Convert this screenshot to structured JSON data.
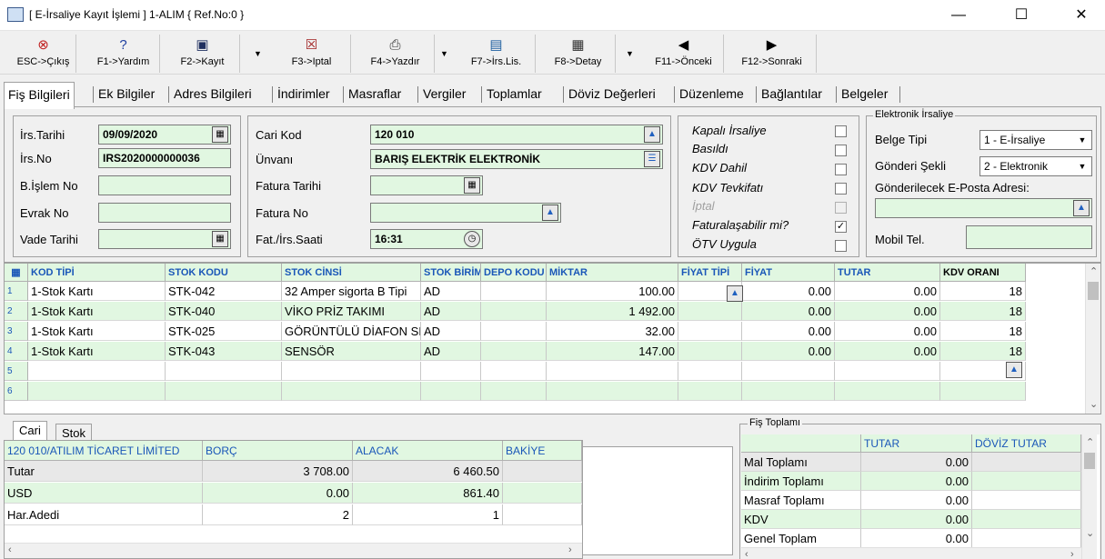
{
  "window": {
    "title": "[ E-İrsaliye Kayıt İşlemi ] 1-ALIM { Ref.No:0 }",
    "minimize": "—",
    "maximize": "☐",
    "close": "✕"
  },
  "toolbar": [
    {
      "label": "ESC->Çıkış",
      "icon": "⊗",
      "color": "#c02020"
    },
    {
      "label": "F1->Yardım",
      "icon": "❓",
      "color": "#2040a0"
    },
    {
      "label": "F2->Kayıt",
      "icon": "🖫",
      "color": "#203060"
    },
    {
      "label": "F3->Iptal",
      "icon": "☒",
      "color": "#a02020"
    },
    {
      "label": "F4->Yazdır",
      "icon": "⎙",
      "color": "#303030"
    },
    {
      "label": "F7->İrs.Lis.",
      "icon": "▤",
      "color": "#2060a0"
    },
    {
      "label": "F8->Detay",
      "icon": "▦",
      "color": "#303030"
    },
    {
      "label": "F11->Önceki",
      "icon": "◆",
      "color": "#000000"
    },
    {
      "label": "F12->Sonraki",
      "icon": "◆",
      "color": "#000000"
    }
  ],
  "tabs": [
    "Fiş Bilgileri",
    "Ek Bilgiler",
    "Adres Bilgileri",
    "İndirimler",
    "Masraflar",
    "Vergiler",
    "Toplamlar",
    "Döviz Değerleri",
    "Düzenleme",
    "Bağlantılar",
    "Belgeler"
  ],
  "form": {
    "irs_tarihi_label": "İrs.Tarihi",
    "irs_tarihi": "09/09/2020",
    "irs_no_label": "İrs.No",
    "irs_no": "IRS2020000000036",
    "bislem_label": "B.İşlem No",
    "bislem": "",
    "evrak_label": "Evrak No",
    "evrak": "",
    "vade_label": "Vade Tarihi",
    "vade": "",
    "cari_kod_label": "Cari Kod",
    "cari_kod": "120 010",
    "unvan_label": "Ünvanı",
    "unvan": "BARIŞ ELEKTRİK ELEKTRONİK",
    "fatura_tarihi_label": "Fatura Tarihi",
    "fatura_tarihi": "",
    "fatura_no_label": "Fatura No",
    "fatura_no": "",
    "saat_label": "Fat./İrs.Saati",
    "saat": "16:31"
  },
  "checks": [
    {
      "label": "Kapalı İrsaliye",
      "checked": false,
      "disabled": false
    },
    {
      "label": "Basıldı",
      "checked": false,
      "disabled": false
    },
    {
      "label": "KDV Dahil",
      "checked": false,
      "disabled": false
    },
    {
      "label": "KDV Tevkifatı",
      "checked": false,
      "disabled": false
    },
    {
      "label": "İptal",
      "checked": false,
      "disabled": true
    },
    {
      "label": "Faturalaşabilir mi?",
      "checked": true,
      "disabled": false
    },
    {
      "label": "ÖTV Uygula",
      "checked": false,
      "disabled": false
    }
  ],
  "einv": {
    "legend": "Elektronik İrsaliye",
    "belge_label": "Belge Tipi",
    "belge": "1 - E-İrsaliye",
    "gonderi_label": "Gönderi Şekli",
    "gonderi": "2 - Elektronik",
    "eposta_label": "Gönderilecek E-Posta Adresi:",
    "eposta": "",
    "mobil_label": "Mobil Tel.",
    "mobil": ""
  },
  "grid": {
    "columns": [
      "KOD TİPİ",
      "STOK KODU",
      "STOK CİNSİ",
      "STOK BİRİM",
      "DEPO KODU",
      "MİKTAR",
      "FİYAT TİPİ",
      "FİYAT",
      "TUTAR",
      "KDV ORANI"
    ],
    "rows": [
      {
        "n": "1",
        "tip": "1-Stok Kartı",
        "kod": "STK-042",
        "cins": "32 Amper sigorta B Tipi",
        "birim": "AD",
        "depo": "",
        "miktar": "100.00",
        "fiyat": "0.00",
        "tutar": "0.00",
        "kdv": "18"
      },
      {
        "n": "2",
        "tip": "1-Stok Kartı",
        "kod": "STK-040",
        "cins": "VİKO PRİZ TAKIMI",
        "birim": "AD",
        "depo": "",
        "miktar": "1 492.00",
        "fiyat": "0.00",
        "tutar": "0.00",
        "kdv": "18"
      },
      {
        "n": "3",
        "tip": "1-Stok Kartı",
        "kod": "STK-025",
        "cins": "GÖRÜNTÜLÜ DİAFON SET",
        "birim": "AD",
        "depo": "",
        "miktar": "32.00",
        "fiyat": "0.00",
        "tutar": "0.00",
        "kdv": "18"
      },
      {
        "n": "4",
        "tip": "1-Stok Kartı",
        "kod": "STK-043",
        "cins": "SENSÖR",
        "birim": "AD",
        "depo": "",
        "miktar": "147.00",
        "fiyat": "0.00",
        "tutar": "0.00",
        "kdv": "18"
      },
      {
        "n": "5",
        "tip": "",
        "kod": "",
        "cins": "",
        "birim": "",
        "depo": "",
        "miktar": "",
        "fiyat": "",
        "tutar": "",
        "kdv": ""
      },
      {
        "n": "6",
        "tip": "",
        "kod": "",
        "cins": "",
        "birim": "",
        "depo": "",
        "miktar": "",
        "fiyat": "",
        "tutar": "",
        "kdv": ""
      }
    ]
  },
  "bottom_tabs": [
    "Cari",
    "Stok"
  ],
  "cari": {
    "title": "120 010/ATILIM TİCARET LİMİTED",
    "headers": [
      "BORÇ",
      "ALACAK",
      "BAKİYE"
    ],
    "rows": [
      {
        "label": "Tutar",
        "borc": "3 708.00",
        "alacak": "6 460.50",
        "bakiye": ""
      },
      {
        "label": "USD",
        "borc": "0.00",
        "alacak": "861.40",
        "bakiye": ""
      },
      {
        "label": "Har.Adedi",
        "borc": "2",
        "alacak": "1",
        "bakiye": ""
      }
    ]
  },
  "totals": {
    "legend": "Fiş Toplamı",
    "headers": [
      "TUTAR",
      "DÖVİZ TUTAR"
    ],
    "rows": [
      {
        "label": "Mal Toplamı",
        "tutar": "0.00"
      },
      {
        "label": "İndirim Toplamı",
        "tutar": "0.00"
      },
      {
        "label": "Masraf Toplamı",
        "tutar": "0.00"
      },
      {
        "label": "KDV",
        "tutar": "0.00"
      },
      {
        "label": "Genel Toplam",
        "tutar": "0.00"
      }
    ]
  }
}
